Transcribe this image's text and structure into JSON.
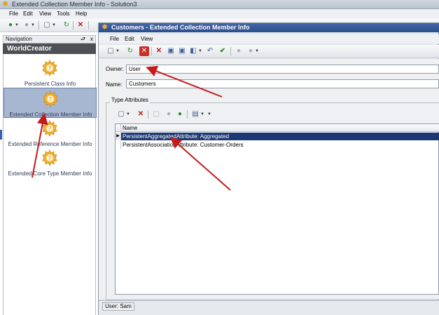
{
  "outer_window": {
    "title": "Extended Collection Member Info - Solution3",
    "menu": [
      "File",
      "Edit",
      "View",
      "Tools",
      "Help"
    ]
  },
  "navigation": {
    "header": "Navigation",
    "pin_glyph": "⮐",
    "close_glyph": "x",
    "group": "WorldCreator",
    "items": [
      {
        "label": "Persistent Class Info"
      },
      {
        "label": "Extended Collection Member Info"
      },
      {
        "label": "Extended Reference Member Info"
      },
      {
        "label": "Extended Core Type Member Info"
      }
    ],
    "selected_index": 1
  },
  "detail_window": {
    "title": "Customers - Extended Collection Member Info",
    "menu": [
      "File",
      "Edit",
      "View"
    ],
    "owner_label": "Owner:",
    "owner_value": "User",
    "name_label": "Name:",
    "name_value": "Customers",
    "group_title": "Type Attributes",
    "grid": {
      "column": "Name",
      "rows": [
        "PersistentAggregatedAttribute: Aggregated",
        "PersistentAssociationAttribute: Customer-Orders"
      ],
      "selected_index": 0
    },
    "status": "User: Sam"
  },
  "colors": {
    "title_active": "#2e4e8d",
    "selection": "#1d3772",
    "arrow": "#c41a1a",
    "gear": "#f0b030"
  }
}
